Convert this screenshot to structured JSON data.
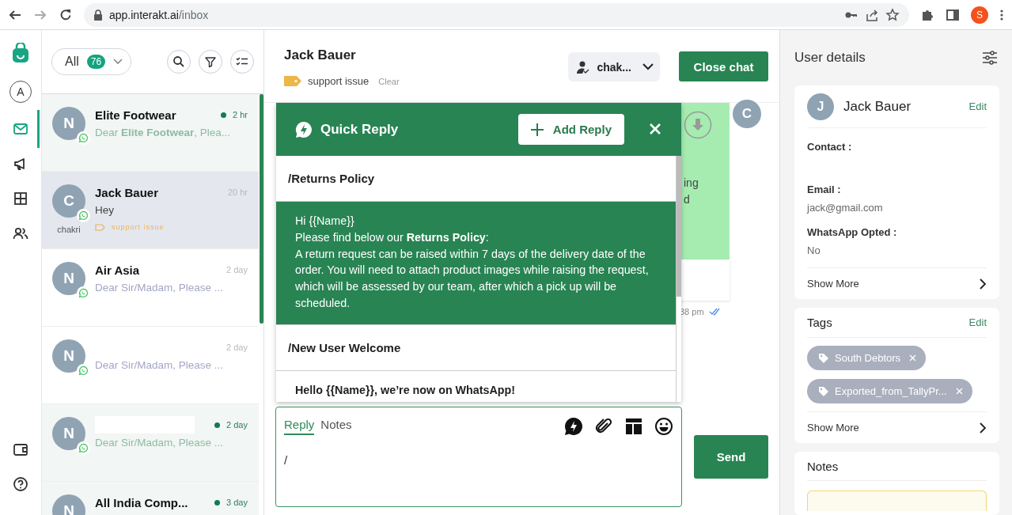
{
  "browser": {
    "url_domain": "app.interakt.ai",
    "url_path": "/inbox",
    "profile_initial": "S"
  },
  "nav": {
    "account_initial": "A",
    "items": [
      {
        "kind": "inbox",
        "selected": true
      },
      {
        "kind": "campaigns",
        "selected": false
      },
      {
        "kind": "apps",
        "selected": false
      },
      {
        "kind": "contacts",
        "selected": false
      }
    ],
    "bottom_items": [
      {
        "kind": "wallet"
      },
      {
        "kind": "help"
      }
    ]
  },
  "inbox_filter": {
    "label": "All",
    "count": "76"
  },
  "conversations": [
    {
      "initial": "N",
      "name": "Elite Footwear",
      "preview": "Dear **Elite Footwear**, Plea...",
      "time": "2 hr",
      "unread": true,
      "selected": false
    },
    {
      "initial": "C",
      "name": "Jack Bauer",
      "preview": "Hey",
      "time": "20 hr",
      "unread": false,
      "selected": true,
      "agent": "chakri",
      "tag": "support issue"
    },
    {
      "initial": "N",
      "name": "Air Asia",
      "preview": "Dear Sir/Madam, Please ...",
      "time": "2 day",
      "unread": false,
      "selected": false
    },
    {
      "initial": "N",
      "preview": "Dear Sir/Madam, Please ...",
      "time": "2 day",
      "unread": false,
      "selected": false
    },
    {
      "initial": "N",
      "redacted": true,
      "preview": "Dear Sir/Madam, Please ...",
      "time": "2 day",
      "unread": true,
      "selected": false
    },
    {
      "initial": "N",
      "name": "All India Comp...",
      "time": "3 day",
      "unread": true,
      "selected": false
    }
  ],
  "chat": {
    "contact_name": "Jack Bauer",
    "tag": "support issue",
    "clear_label": "Clear",
    "assignee": "chak...",
    "close_button": "Close chat",
    "avatar_initial": "C",
    "message_fragments": [
      "ing",
      "d"
    ],
    "message_time": "38 pm"
  },
  "quick_reply": {
    "title": "Quick Reply",
    "add_button": "Add Reply",
    "replies": [
      {
        "title": "/Returns Policy",
        "body": "Hi {{Name}}\nPlease find below our **Returns Policy**:\nA return request can be raised within 7 days of the delivery date of the order. You will need to attach product images while raising the request, which will be assessed by our team, after which a pick up will be scheduled.",
        "selected": true
      },
      {
        "title": "/New User Welcome",
        "body": "Hello {{Name}}, we’re now on WhatsApp!",
        "selected": false
      }
    ]
  },
  "composer": {
    "tabs": [
      {
        "label": "Reply",
        "selected": true
      },
      {
        "label": "Notes",
        "selected": false
      }
    ],
    "value": "/",
    "send_button": "Send"
  },
  "user_details": {
    "title": "User details",
    "initial": "J",
    "name": "Jack Bauer",
    "edit_label": "Edit",
    "fields": [
      {
        "label": "Contact :"
      },
      {
        "label": "Email :",
        "value": "jack@gmail.com"
      },
      {
        "label": "WhatsApp Opted :",
        "value": "No"
      }
    ],
    "show_more": "Show More",
    "tags_title": "Tags",
    "tags_edit": "Edit",
    "tags": [
      "South Debtors",
      "Exported_from_TallyPr..."
    ],
    "tags_show_more": "Show More",
    "notes_title": "Notes"
  }
}
